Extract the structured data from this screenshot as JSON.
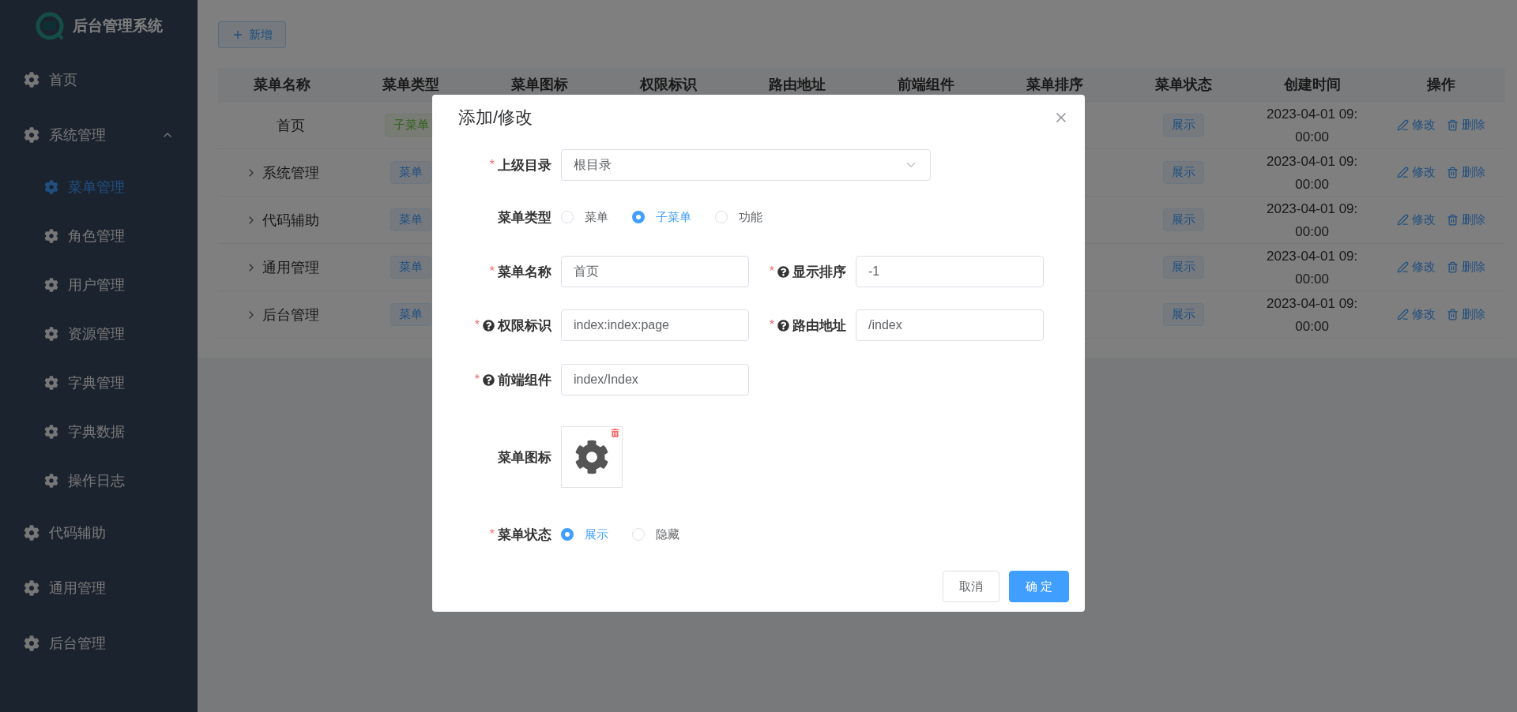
{
  "sidebar": {
    "logo_text": "后台管理系统",
    "items": [
      {
        "label": "首页",
        "selected": false,
        "expanded": false
      },
      {
        "label": "系统管理",
        "selected": false,
        "expanded": true,
        "children": [
          {
            "label": "菜单管理",
            "selected": true
          },
          {
            "label": "角色管理",
            "selected": false
          },
          {
            "label": "用户管理",
            "selected": false
          },
          {
            "label": "资源管理",
            "selected": false
          },
          {
            "label": "字典管理",
            "selected": false
          },
          {
            "label": "字典数据",
            "selected": false
          },
          {
            "label": "操作日志",
            "selected": false
          }
        ]
      },
      {
        "label": "代码辅助",
        "selected": false,
        "expanded": false
      },
      {
        "label": "通用管理",
        "selected": false,
        "expanded": false
      },
      {
        "label": "后台管理",
        "selected": false,
        "expanded": false
      }
    ]
  },
  "toolbar": {
    "add_button": "新增"
  },
  "table": {
    "columns": [
      "菜单名称",
      "菜单类型",
      "菜单图标",
      "权限标识",
      "路由地址",
      "前端组件",
      "菜单排序",
      "菜单状态",
      "创建时间",
      "操作"
    ],
    "rows": [
      {
        "name": "首页",
        "expandable": false,
        "type": {
          "label": "子菜单",
          "kind": "submenu"
        },
        "status": "展示",
        "created": "2023-04-01 09:00:00",
        "actions": [
          "修改",
          "删除"
        ]
      },
      {
        "name": "系统管理",
        "expandable": true,
        "type": {
          "label": "菜单",
          "kind": "menu"
        },
        "status": "展示",
        "created": "2023-04-01 09:00:00",
        "actions": [
          "修改",
          "删除"
        ]
      },
      {
        "name": "代码辅助",
        "expandable": true,
        "type": {
          "label": "菜单",
          "kind": "menu"
        },
        "status": "展示",
        "created": "2023-04-01 09:00:00",
        "actions": [
          "修改",
          "删除"
        ]
      },
      {
        "name": "通用管理",
        "expandable": true,
        "type": {
          "label": "菜单",
          "kind": "menu"
        },
        "status": "展示",
        "created": "2023-04-01 09:00:00",
        "actions": [
          "修改",
          "删除"
        ]
      },
      {
        "name": "后台管理",
        "expandable": true,
        "type": {
          "label": "菜单",
          "kind": "menu"
        },
        "status": "展示",
        "created": "2023-04-01 09:00:00",
        "actions": [
          "修改",
          "删除"
        ]
      }
    ]
  },
  "dialog": {
    "title": "添加/修改",
    "rows": [
      {
        "fields": [
          {
            "kind": "select",
            "label": "上级目录",
            "required_mark": "*",
            "value": "根目录"
          }
        ]
      },
      {
        "fields": [
          {
            "kind": "radio",
            "label": "菜单类型",
            "options": [
              {
                "label": "菜单",
                "selected": false
              },
              {
                "label": "子菜单",
                "selected": true
              },
              {
                "label": "功能",
                "selected": false
              }
            ]
          }
        ]
      },
      {
        "fields": [
          {
            "kind": "text",
            "label": "菜单名称",
            "required_mark": "*",
            "value": "首页"
          },
          {
            "kind": "text",
            "label": "显示排序",
            "required_mark": "*",
            "help": true,
            "value": "-1"
          }
        ]
      },
      {
        "fields": [
          {
            "kind": "text",
            "label": "权限标识",
            "required_mark": "*",
            "help": true,
            "value": "index:index:page"
          },
          {
            "kind": "text",
            "label": "路由地址",
            "required_mark": "*",
            "help": true,
            "value": "/index"
          }
        ]
      },
      {
        "fields": [
          {
            "kind": "text",
            "label": "前端组件",
            "required_mark": "*",
            "help": true,
            "value": "index/Index"
          }
        ]
      },
      {
        "fields": [
          {
            "kind": "icon",
            "label": "菜单图标"
          }
        ]
      },
      {
        "fields": [
          {
            "kind": "radio",
            "label": "菜单状态",
            "required_mark": "*",
            "options": [
              {
                "label": "展示",
                "selected": true
              },
              {
                "label": "隐藏",
                "selected": false
              }
            ]
          }
        ]
      }
    ],
    "buttons": [
      {
        "label": "取消",
        "kind": "default"
      },
      {
        "label": "确 定",
        "kind": "primary"
      }
    ]
  }
}
